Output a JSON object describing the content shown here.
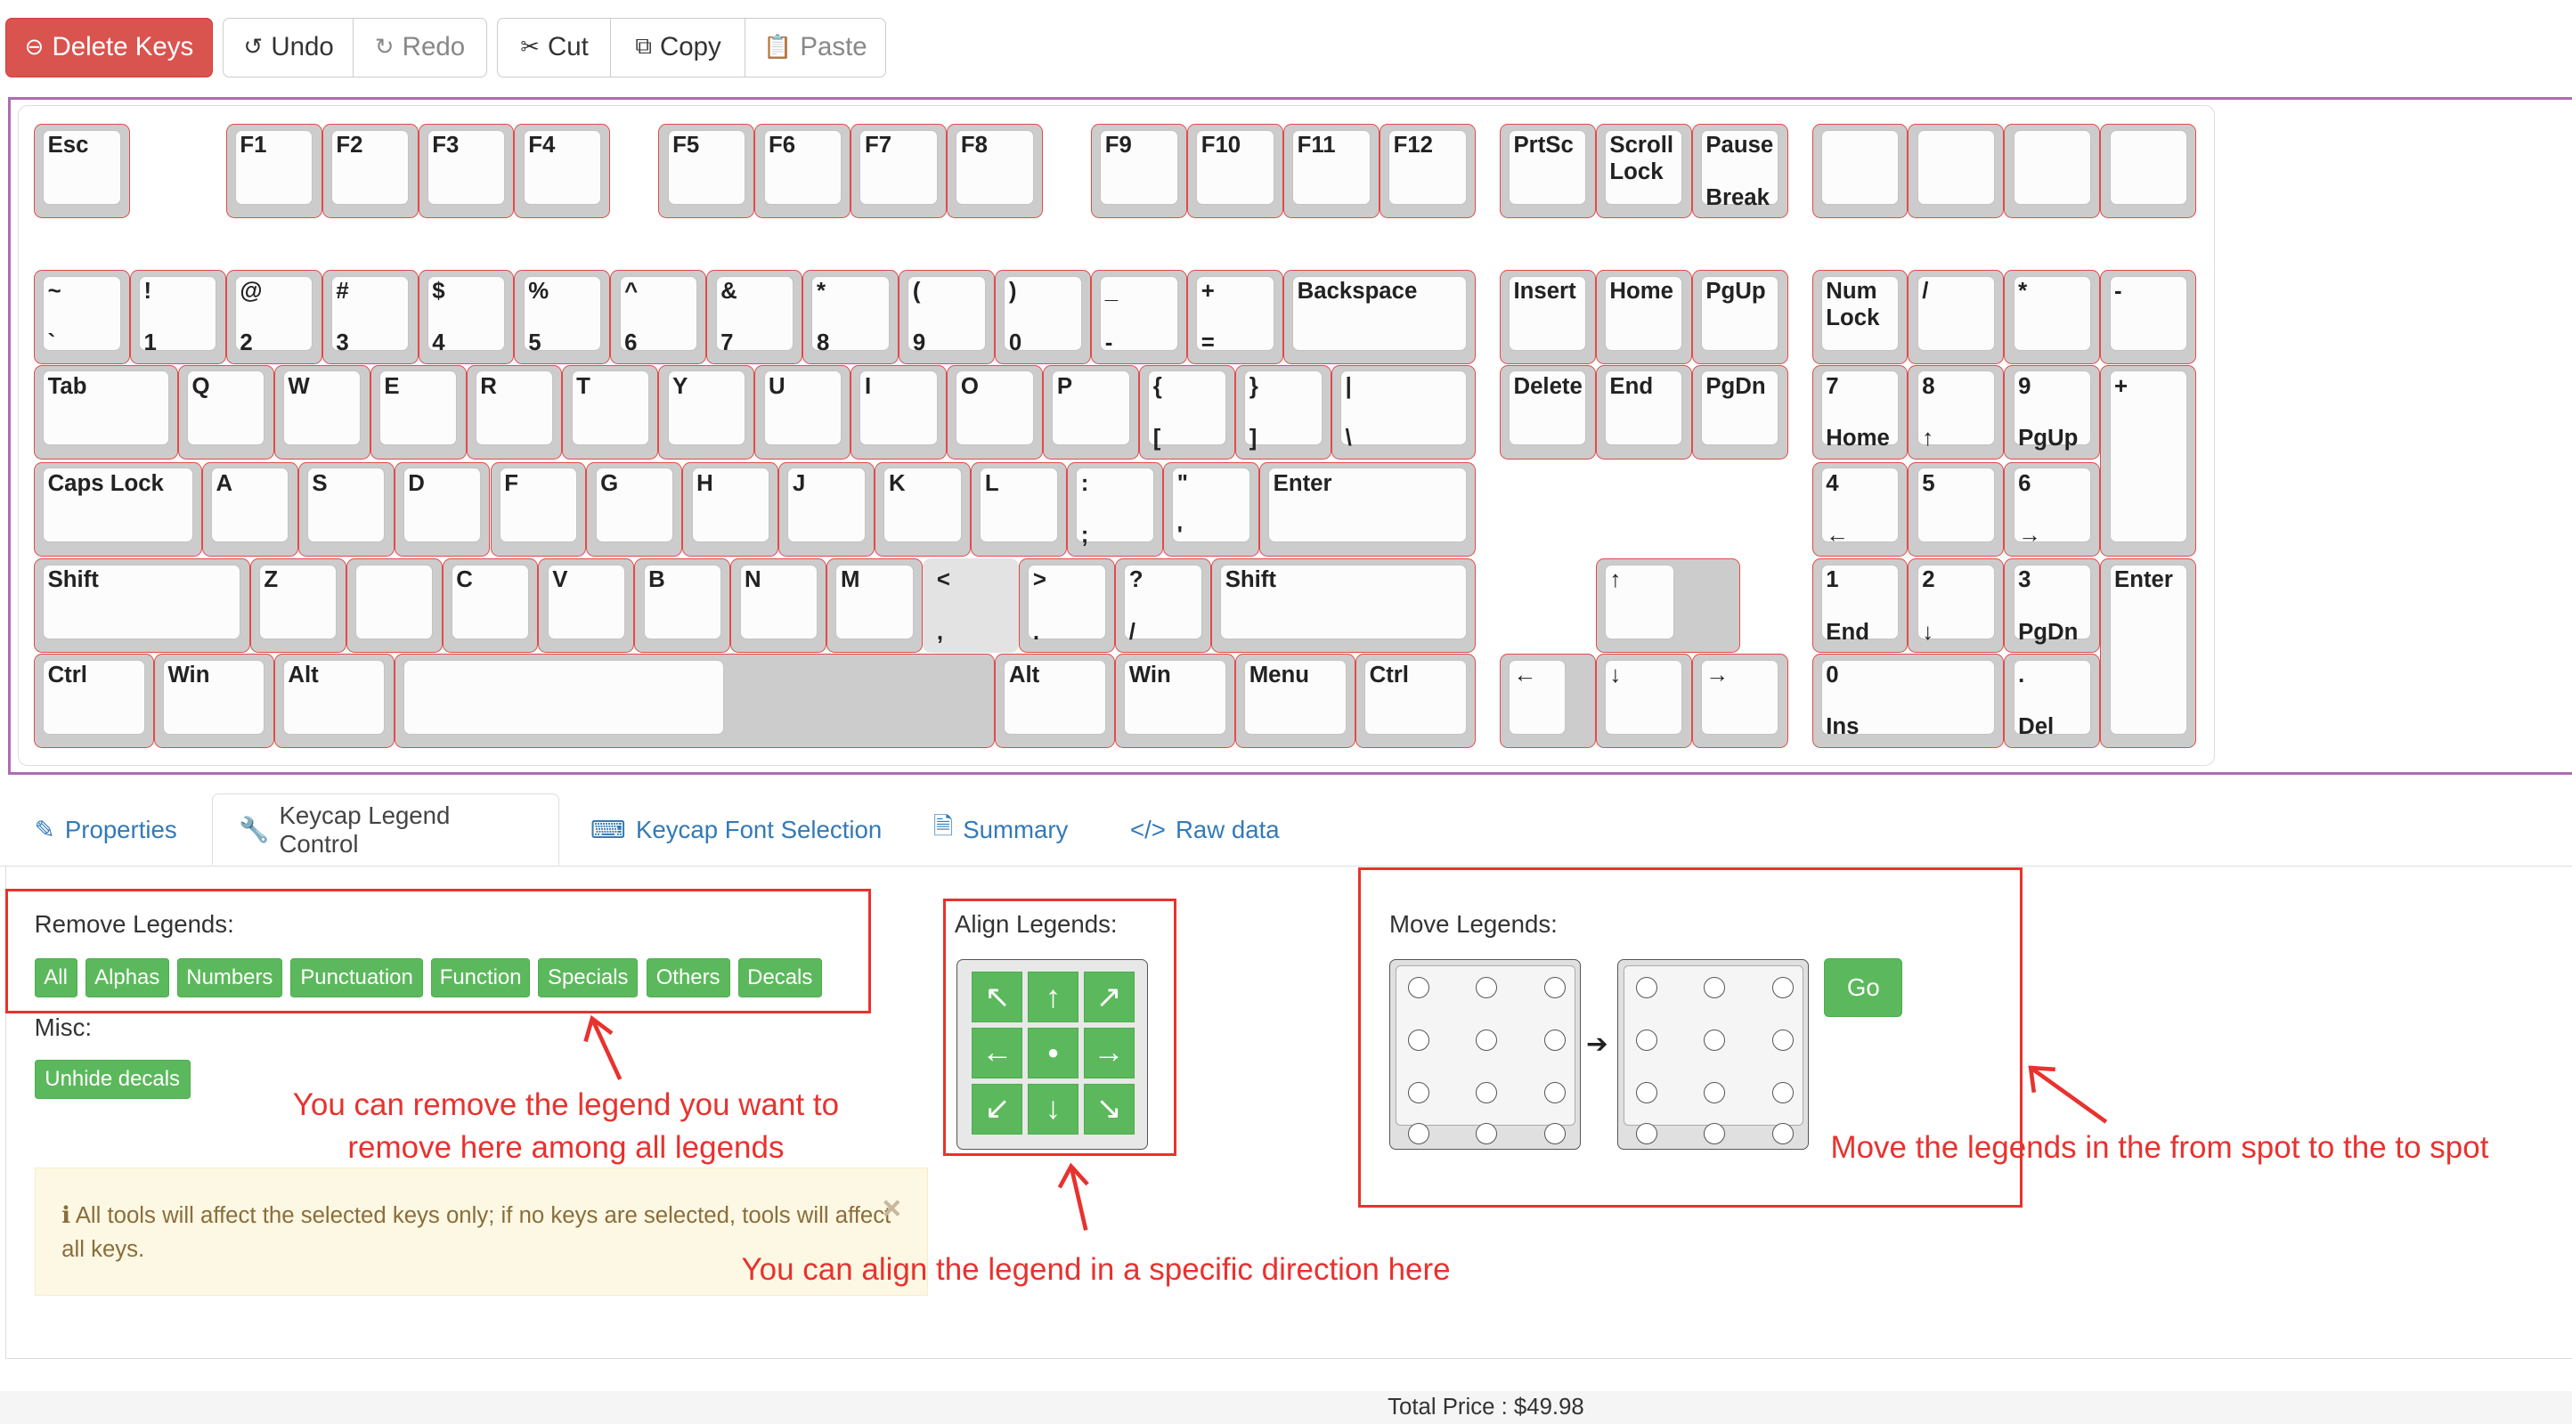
{
  "toolbar": {
    "delete_label": "Delete Keys",
    "undo_label": "Undo",
    "redo_label": "Redo",
    "cut_label": "Cut",
    "copy_label": "Copy",
    "paste_label": "Paste"
  },
  "keyboard": {
    "keys": [
      {
        "tl": "Esc",
        "bl": ""
      },
      {
        "tl": "F1",
        "bl": ""
      },
      {
        "tl": "F2",
        "bl": ""
      },
      {
        "tl": "F3",
        "bl": ""
      },
      {
        "tl": "F4",
        "bl": ""
      },
      {
        "tl": "F5",
        "bl": ""
      },
      {
        "tl": "F6",
        "bl": ""
      },
      {
        "tl": "F7",
        "bl": ""
      },
      {
        "tl": "F8",
        "bl": ""
      },
      {
        "tl": "F9",
        "bl": ""
      },
      {
        "tl": "F10",
        "bl": ""
      },
      {
        "tl": "F11",
        "bl": ""
      },
      {
        "tl": "F12",
        "bl": ""
      },
      {
        "tl": "PrtSc",
        "bl": ""
      },
      {
        "tl": "Scroll\nLock",
        "bl": ""
      },
      {
        "tl": "Pause",
        "bl": "Break"
      },
      {
        "tl": "",
        "bl": ""
      },
      {
        "tl": "",
        "bl": ""
      },
      {
        "tl": "",
        "bl": ""
      },
      {
        "tl": "",
        "bl": ""
      },
      {
        "tl": "~",
        "bl": "`"
      },
      {
        "tl": "!",
        "bl": "1"
      },
      {
        "tl": "@",
        "bl": "2"
      },
      {
        "tl": "#",
        "bl": "3"
      },
      {
        "tl": "$",
        "bl": "4"
      },
      {
        "tl": "%",
        "bl": "5"
      },
      {
        "tl": "^",
        "bl": "6"
      },
      {
        "tl": "&",
        "bl": "7"
      },
      {
        "tl": "*",
        "bl": "8"
      },
      {
        "tl": "(",
        "bl": "9"
      },
      {
        "tl": ")",
        "bl": "0"
      },
      {
        "tl": "_",
        "bl": "-"
      },
      {
        "tl": "+",
        "bl": "="
      },
      {
        "tl": "Backspace",
        "bl": ""
      },
      {
        "tl": "Insert",
        "bl": ""
      },
      {
        "tl": "Home",
        "bl": ""
      },
      {
        "tl": "PgUp",
        "bl": ""
      },
      {
        "tl": "Num\nLock",
        "bl": ""
      },
      {
        "tl": "/",
        "bl": ""
      },
      {
        "tl": "*",
        "bl": ""
      },
      {
        "tl": "-",
        "bl": ""
      },
      {
        "tl": "Tab",
        "bl": ""
      },
      {
        "tl": "Q",
        "bl": ""
      },
      {
        "tl": "W",
        "bl": ""
      },
      {
        "tl": "E",
        "bl": ""
      },
      {
        "tl": "R",
        "bl": ""
      },
      {
        "tl": "T",
        "bl": ""
      },
      {
        "tl": "Y",
        "bl": ""
      },
      {
        "tl": "U",
        "bl": ""
      },
      {
        "tl": "I",
        "bl": ""
      },
      {
        "tl": "O",
        "bl": ""
      },
      {
        "tl": "P",
        "bl": ""
      },
      {
        "tl": "{",
        "bl": "["
      },
      {
        "tl": "}",
        "bl": "]"
      },
      {
        "tl": "|",
        "bl": "\\"
      },
      {
        "tl": "Delete",
        "bl": ""
      },
      {
        "tl": "End",
        "bl": ""
      },
      {
        "tl": "PgDn",
        "bl": ""
      },
      {
        "tl": "7",
        "bl": "Home"
      },
      {
        "tl": "8",
        "bl": "↑"
      },
      {
        "tl": "9",
        "bl": "PgUp"
      },
      {
        "tl": "+",
        "bl": ""
      },
      {
        "tl": "Caps Lock",
        "bl": ""
      },
      {
        "tl": "A",
        "bl": ""
      },
      {
        "tl": "S",
        "bl": ""
      },
      {
        "tl": "D",
        "bl": ""
      },
      {
        "tl": "F",
        "bl": ""
      },
      {
        "tl": "G",
        "bl": ""
      },
      {
        "tl": "H",
        "bl": ""
      },
      {
        "tl": "J",
        "bl": ""
      },
      {
        "tl": "K",
        "bl": ""
      },
      {
        "tl": "L",
        "bl": ""
      },
      {
        "tl": ":",
        "bl": ";"
      },
      {
        "tl": "\"",
        "bl": "'"
      },
      {
        "tl": "Enter",
        "bl": ""
      },
      {
        "tl": "4",
        "bl": "←"
      },
      {
        "tl": "5",
        "bl": ""
      },
      {
        "tl": "6",
        "bl": "→"
      },
      {
        "tl": "Shift",
        "bl": ""
      },
      {
        "tl": "Z",
        "bl": ""
      },
      {
        "tl": "",
        "bl": ""
      },
      {
        "tl": "C",
        "bl": ""
      },
      {
        "tl": "V",
        "bl": ""
      },
      {
        "tl": "B",
        "bl": ""
      },
      {
        "tl": "N",
        "bl": ""
      },
      {
        "tl": "M",
        "bl": ""
      },
      {
        "tl": "<",
        "bl": ","
      },
      {
        "tl": ">",
        "bl": "."
      },
      {
        "tl": "?",
        "bl": "/"
      },
      {
        "tl": "Shift",
        "bl": ""
      },
      {
        "tl": "↑",
        "bl": ""
      },
      {
        "tl": "1",
        "bl": "End"
      },
      {
        "tl": "2",
        "bl": "↓"
      },
      {
        "tl": "3",
        "bl": "PgDn"
      },
      {
        "tl": "Enter",
        "bl": ""
      },
      {
        "tl": "Ctrl",
        "bl": ""
      },
      {
        "tl": "Win",
        "bl": ""
      },
      {
        "tl": "Alt",
        "bl": ""
      },
      {
        "tl": "",
        "bl": ""
      },
      {
        "tl": "Alt",
        "bl": ""
      },
      {
        "tl": "Win",
        "bl": ""
      },
      {
        "tl": "Menu",
        "bl": ""
      },
      {
        "tl": "Ctrl",
        "bl": ""
      },
      {
        "tl": "←",
        "bl": ""
      },
      {
        "tl": "↓",
        "bl": ""
      },
      {
        "tl": "→",
        "bl": ""
      },
      {
        "tl": "0",
        "bl": "Ins"
      },
      {
        "tl": ".",
        "bl": "Del"
      }
    ]
  },
  "tabs": [
    {
      "label": "Properties",
      "icon": "edit-icon"
    },
    {
      "label": "Keycap Legend Control",
      "icon": "wrench-icon"
    },
    {
      "label": "Keycap Font Selection",
      "icon": "keyboard-icon"
    },
    {
      "label": "Summary",
      "icon": "file-icon"
    },
    {
      "label": "Raw data",
      "icon": "code-icon"
    }
  ],
  "legend_control": {
    "remove_title": "Remove Legends:",
    "remove_buttons": [
      "All",
      "Alphas",
      "Numbers",
      "Punctuation",
      "Function",
      "Specials",
      "Others",
      "Decals"
    ],
    "misc_title": "Misc:",
    "unhide_label": "Unhide decals",
    "align_title": "Align Legends:",
    "align_arrows": [
      "↖",
      "↑",
      "↗",
      "←",
      "●",
      "→",
      "↙",
      "↓",
      "↘"
    ],
    "move_title": "Move Legends:",
    "go_label": "Go",
    "alert_text": "All tools will affect the selected keys only; if no keys are selected, tools will affect all keys.",
    "alert_close": "×"
  },
  "annotations": {
    "remove_note_line1": "You can remove the legend you want to",
    "remove_note_line2": "remove here among all legends",
    "align_note": "You can align the legend in a specific direction here",
    "move_note": "Move the legends in the from spot to the to spot",
    "color": "#e8322e"
  },
  "footer": {
    "total_text": "Total Price : $49.98"
  }
}
